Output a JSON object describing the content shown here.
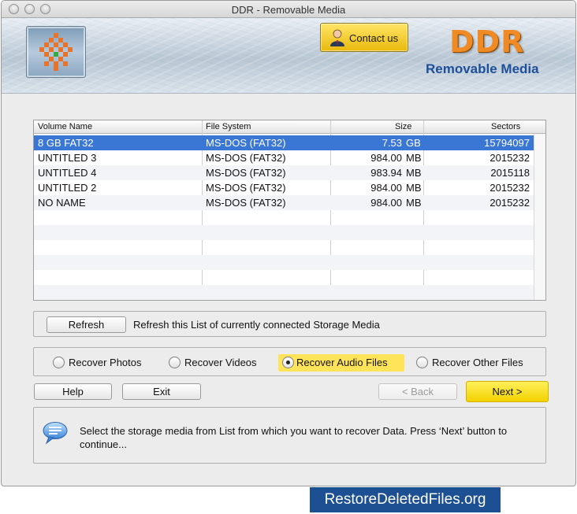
{
  "window": {
    "title": "DDR - Removable Media"
  },
  "header": {
    "contact_label": "Contact us",
    "brand": "DDR",
    "brand_sub": "Removable Media"
  },
  "list": {
    "columns": [
      "Volume Name",
      "File System",
      "Size",
      "Sectors"
    ],
    "rows": [
      {
        "name": "8 GB FAT32",
        "fs": "MS-DOS (FAT32)",
        "size": "7.53",
        "unit": "GB",
        "sectors": "15794097"
      },
      {
        "name": "UNTITLED 3",
        "fs": "MS-DOS (FAT32)",
        "size": "984.00",
        "unit": "MB",
        "sectors": "2015232"
      },
      {
        "name": "UNTITLED 4",
        "fs": "MS-DOS (FAT32)",
        "size": "983.94",
        "unit": "MB",
        "sectors": "2015118"
      },
      {
        "name": "UNTITLED 2",
        "fs": "MS-DOS (FAT32)",
        "size": "984.00",
        "unit": "MB",
        "sectors": "2015232"
      },
      {
        "name": "NO NAME",
        "fs": "MS-DOS (FAT32)",
        "size": "984.00",
        "unit": "MB",
        "sectors": "2015232"
      }
    ]
  },
  "refresh": {
    "button_label": "Refresh",
    "description": "Refresh this List of currently connected Storage Media"
  },
  "recovery_options": {
    "photos": "Recover Photos",
    "videos": "Recover Videos",
    "audio": "Recover Audio Files",
    "other": "Recover Other Files",
    "selected": "audio"
  },
  "actions": {
    "help": "Help",
    "exit": "Exit",
    "back": "< Back",
    "next": "Next >"
  },
  "info": {
    "icon": "speech-bubble-icon",
    "message": "Select the storage media from List from which you want to recover Data. Press ‘Next’ button to continue..."
  },
  "watermark": "RestoreDeletedFiles.org",
  "colors": {
    "selection": "#3a76d4",
    "highlight": "#ffe45a",
    "brand_orange": "#f08a24",
    "brand_blue": "#1e4f9a"
  }
}
